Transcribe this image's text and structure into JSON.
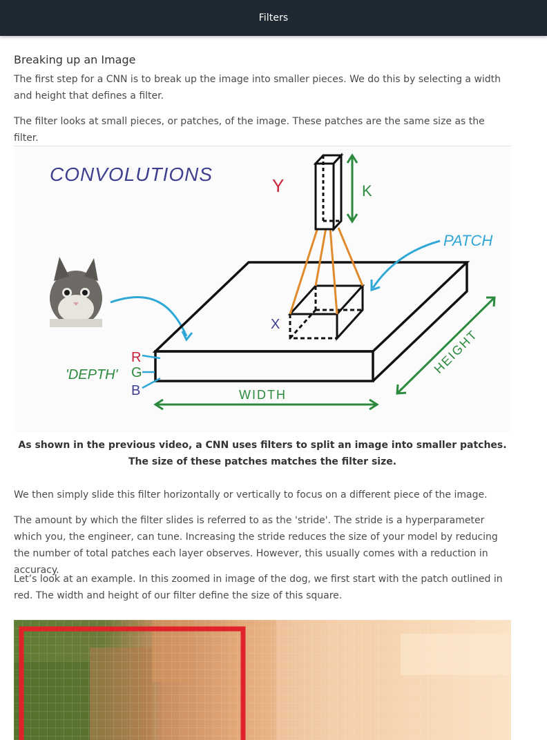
{
  "header": {
    "title": "Filters"
  },
  "section": {
    "heading": "Breaking up an Image",
    "paragraph_1": "The first step for a CNN is to break up the image into smaller pieces. We do this by selecting a width and height that defines a filter.",
    "paragraph_2": "The filter looks at small pieces, or patches, of the image. These patches are the same size as the filter.",
    "figure_1": {
      "labels": {
        "convolutions": "CONVOLUTIONS",
        "y": "Y",
        "k": "K",
        "patch": "PATCH",
        "x": "X",
        "r": "R",
        "g": "G",
        "b": "B",
        "depth": "'DEPTH'",
        "width": "WIDTH",
        "height": "HEIGHT"
      },
      "colors": {
        "purple": "#3f3f8f",
        "red": "#c8213a",
        "green": "#2b8a3e",
        "blue": "#2ea7d6",
        "orange": "#e08a2b",
        "black": "#111111"
      }
    },
    "caption": "As shown in the previous video, a CNN uses filters to split an image into smaller patches. The size of these patches matches the filter size.",
    "paragraph_3": "We then simply slide this filter horizontally or vertically to focus on a different piece of the image.",
    "paragraph_4": "The amount by which the filter slides is referred to as the 'stride'. The stride is a hyperparameter which you, the engineer, can tune. Increasing the stride reduces the size of your model by reducing the number of total patches each layer observes. However, this usually comes with a reduction in accuracy.",
    "paragraph_5": "Let’s look at an example. In this zoomed in image of the dog, we first start with the patch outlined in red. The width and height of our filter define the size of this square.",
    "figure_2": {
      "outline_color": "#e0232b"
    }
  }
}
